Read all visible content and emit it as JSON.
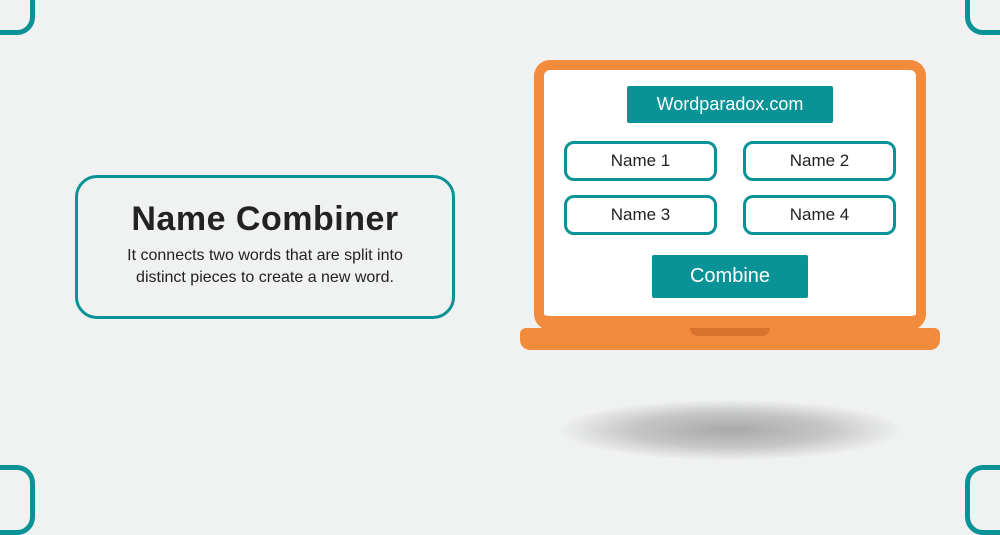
{
  "info": {
    "title": "Name Combiner",
    "description": "It connects two words that are split into distinct pieces to create a new word."
  },
  "laptop": {
    "site_label": "Wordparadox.com",
    "fields": [
      "Name 1",
      "Name 2",
      "Name 3",
      "Name 4"
    ],
    "button_label": "Combine"
  },
  "colors": {
    "teal": "#0a9396",
    "orange": "#f28b3b",
    "background": "#f0f1f1"
  }
}
